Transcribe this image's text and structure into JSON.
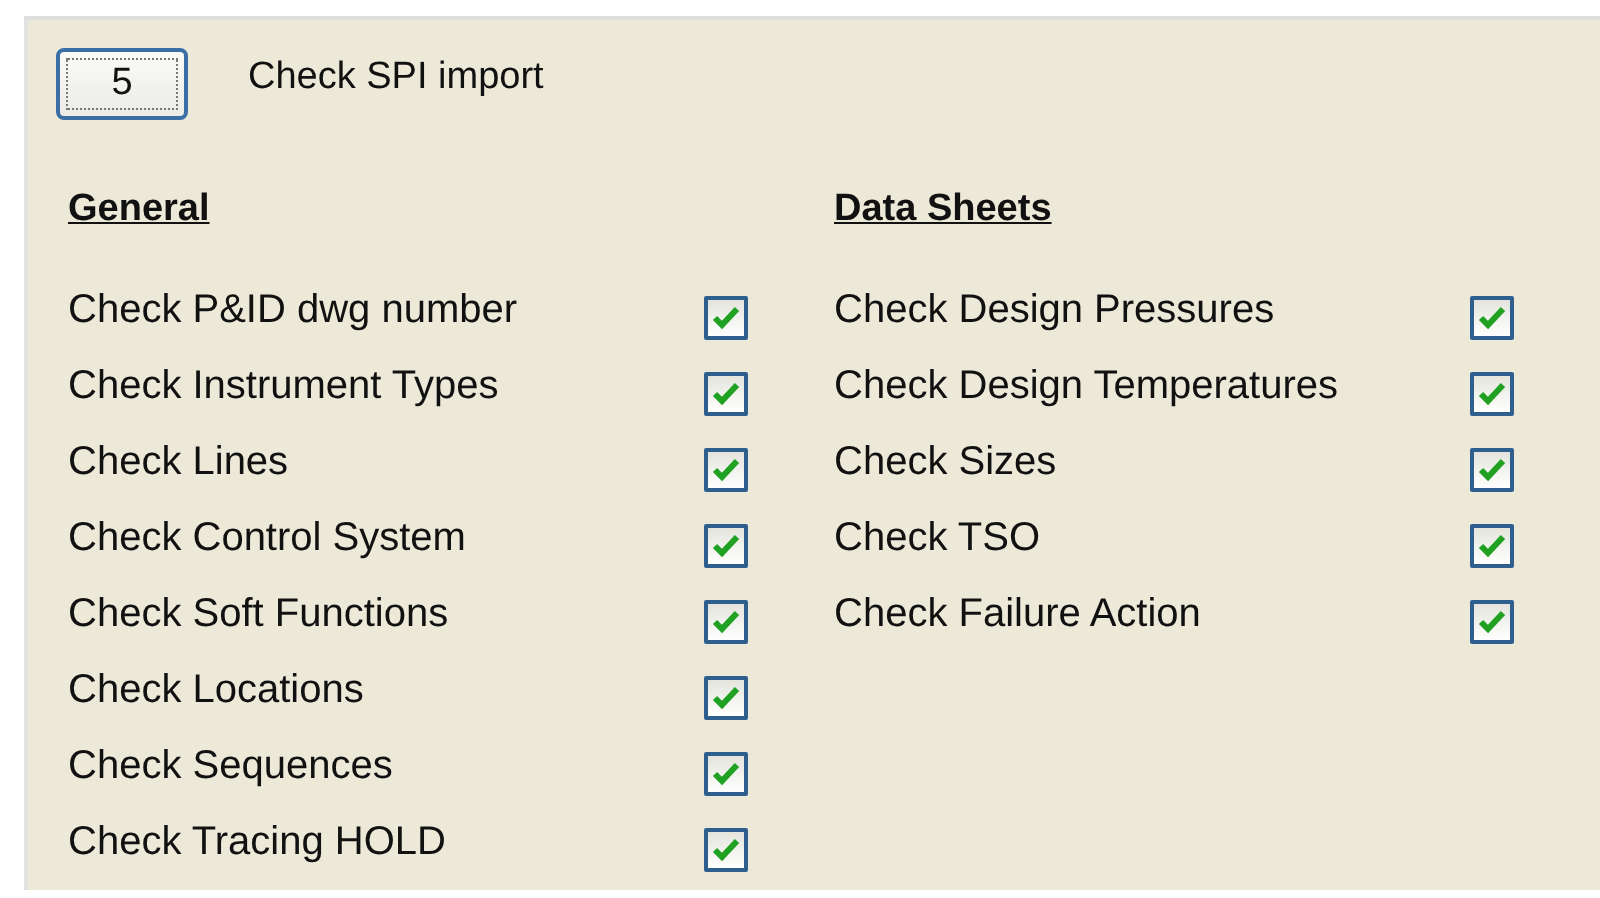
{
  "counter_button": {
    "label": "5"
  },
  "title": "Check SPI import",
  "sections": [
    {
      "heading": "General",
      "items": [
        {
          "label": "Check P&ID dwg number",
          "checked": true
        },
        {
          "label": "Check Instrument Types",
          "checked": true
        },
        {
          "label": "Check Lines",
          "checked": true
        },
        {
          "label": "Check Control System",
          "checked": true
        },
        {
          "label": "Check Soft Functions",
          "checked": true
        },
        {
          "label": "Check Locations",
          "checked": true
        },
        {
          "label": "Check Sequences",
          "checked": true
        },
        {
          "label": "Check Tracing HOLD",
          "checked": true
        }
      ]
    },
    {
      "heading": "Data Sheets",
      "items": [
        {
          "label": "Check Design Pressures",
          "checked": true
        },
        {
          "label": "Check Design Temperatures",
          "checked": true
        },
        {
          "label": "Check Sizes",
          "checked": true
        },
        {
          "label": "Check TSO",
          "checked": true
        },
        {
          "label": "Check Failure Action",
          "checked": true
        }
      ]
    }
  ]
}
